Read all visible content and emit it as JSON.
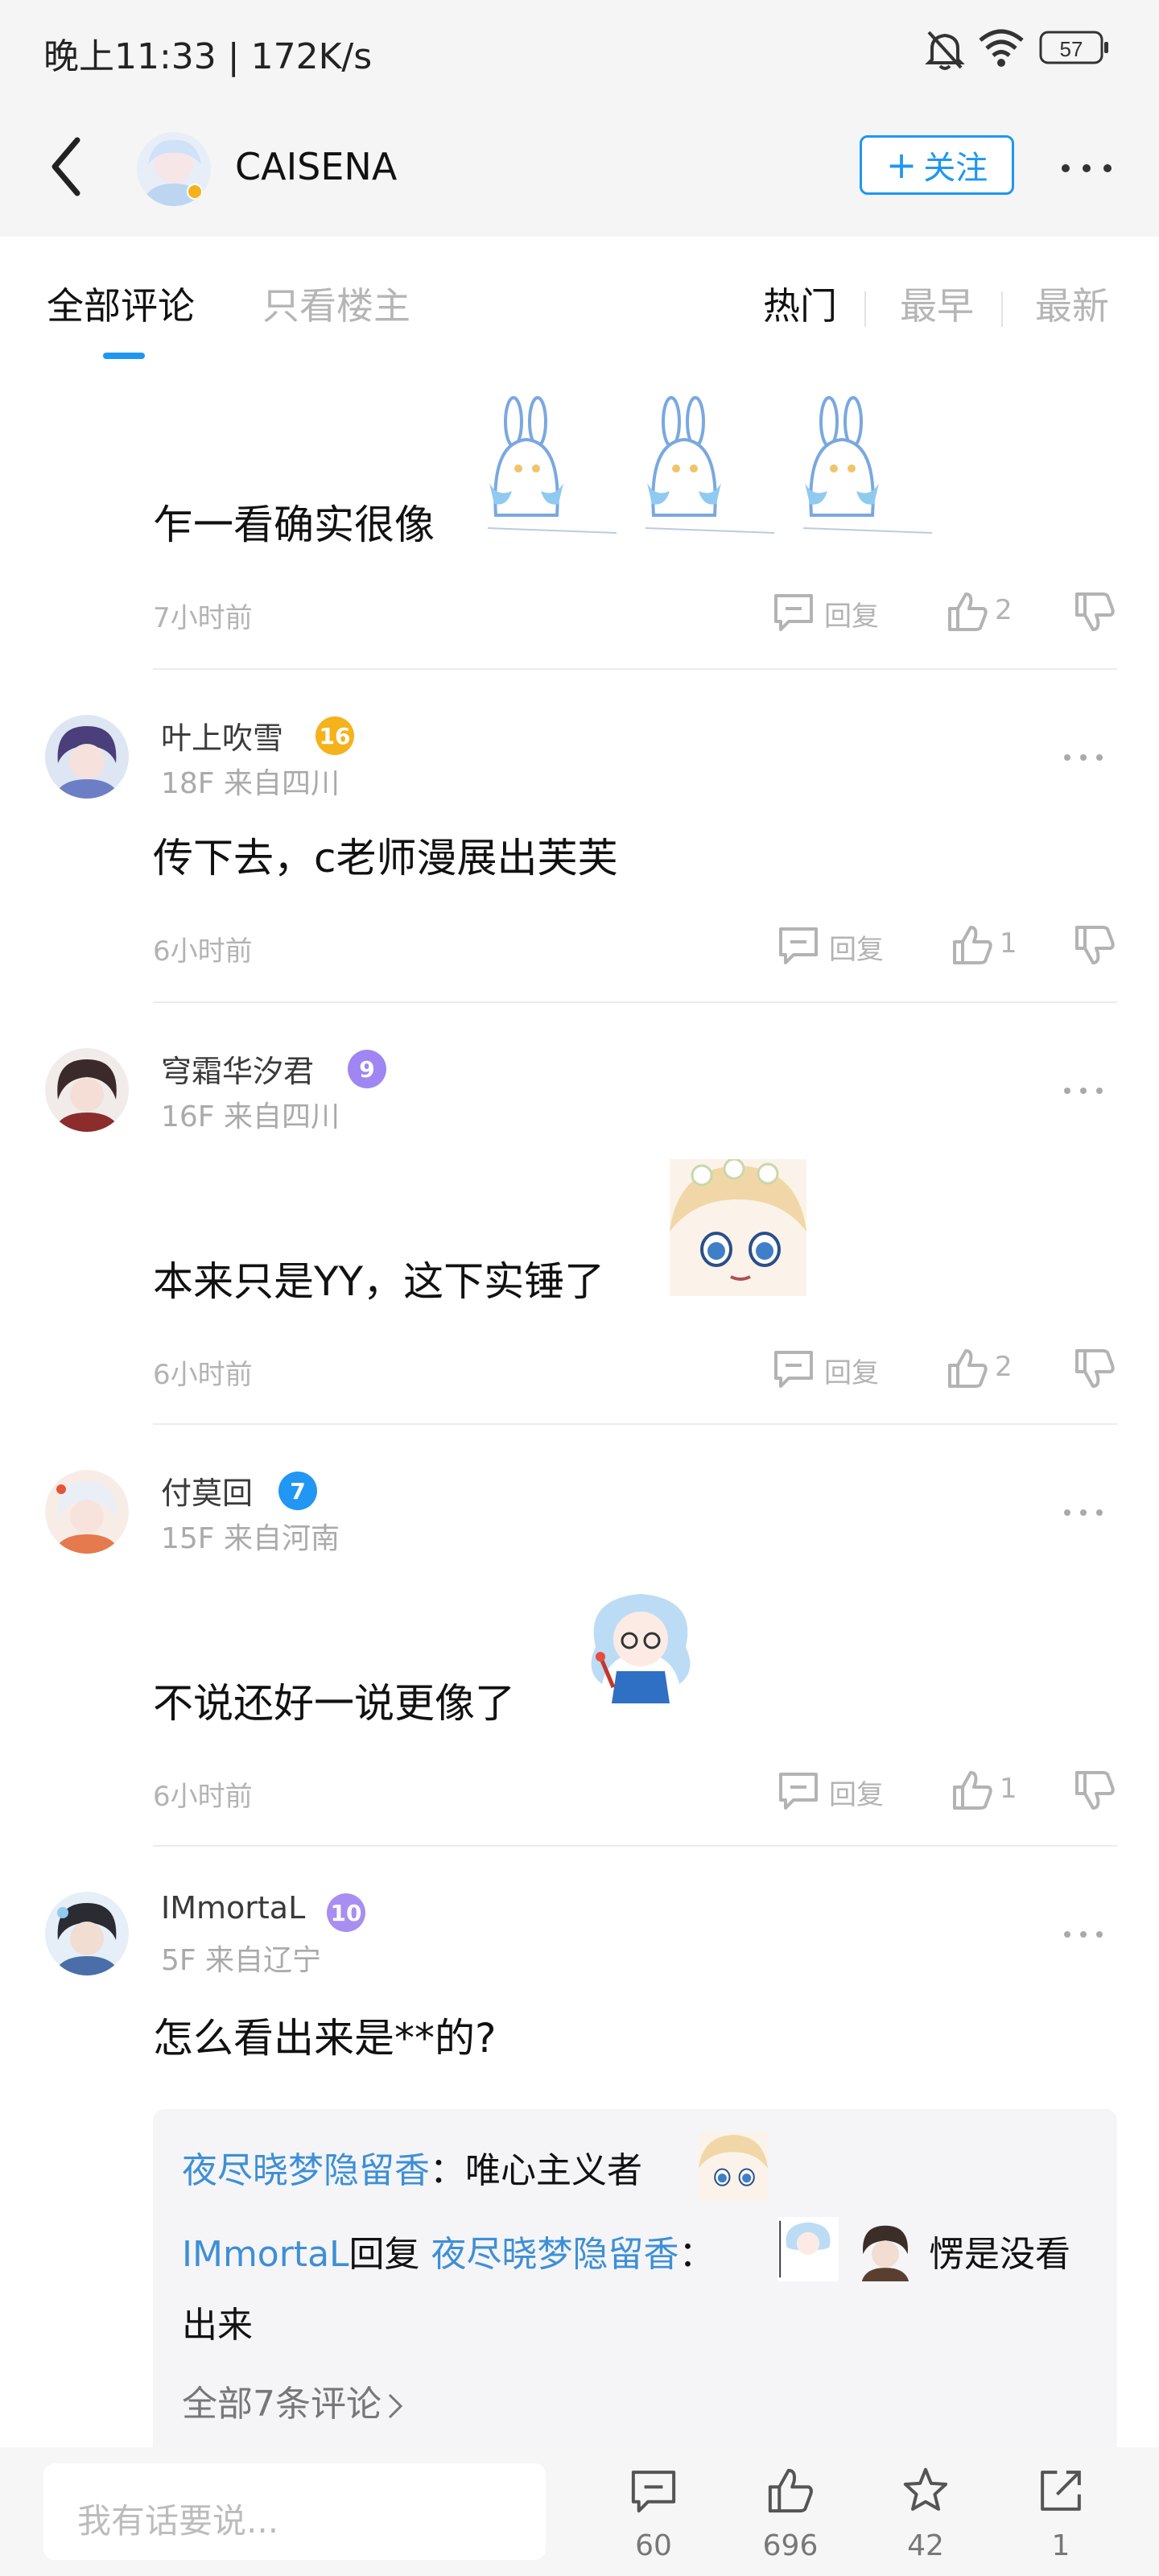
{
  "status_bar": {
    "time": "晚上11:33 | 172K/s",
    "battery": "57"
  },
  "nav": {
    "author_name": "CAISENA",
    "follow_label": "关注",
    "plus": "+"
  },
  "filters": {
    "all": "全部评论",
    "op_only": "只看楼主",
    "hot": "热门",
    "earliest": "最早",
    "latest": "最新"
  },
  "colors": {
    "accent": "#1e97f2",
    "link": "#3d8fd6",
    "badge_gold": "#f5b21a",
    "badge_purple": "#9f86f2",
    "badge_blue": "#2196f3",
    "badge_lavender": "#a88ef0"
  },
  "reply_label": "回复",
  "comments": [
    {
      "text": "乍一看确实很像",
      "time": "7小时前",
      "likes": "2",
      "stickers": [
        "bunny-sticker",
        "bunny-sticker",
        "bunny-sticker"
      ]
    },
    {
      "name": "叶上吹雪",
      "level": "16",
      "meta": "18F 来自四川",
      "text": "传下去，c老师漫展出芙芙",
      "time": "6小时前",
      "likes": "1"
    },
    {
      "name": "穹霜华汐君",
      "level": "9",
      "meta": "16F 来自四川",
      "text": "本来只是YY，这下实锤了",
      "time": "6小时前",
      "likes": "2"
    },
    {
      "name": "付莫回",
      "level": "7",
      "meta": "15F 来自河南",
      "text": "不说还好一说更像了",
      "time": "6小时前",
      "likes": "1"
    },
    {
      "name": "IMmortaL",
      "level": "10",
      "meta": "5F 来自辽宁",
      "text": "怎么看出来是**的?"
    }
  ],
  "sub_replies": {
    "r1_user": "夜尽晓梦隐留香",
    "r1_sep": "：",
    "r1_text": "唯心主义者",
    "r2_user": "IMmortaL",
    "r2_mid": "回复",
    "r2_target": "夜尽晓梦隐留香",
    "r2_sep": "：",
    "r2_text": "愣是没看",
    "r2_text2": "出来",
    "all": "全部7条评论"
  },
  "bottom": {
    "placeholder": "我有话要说...",
    "comments": "60",
    "likes": "696",
    "favorites": "42",
    "shares": "1"
  }
}
